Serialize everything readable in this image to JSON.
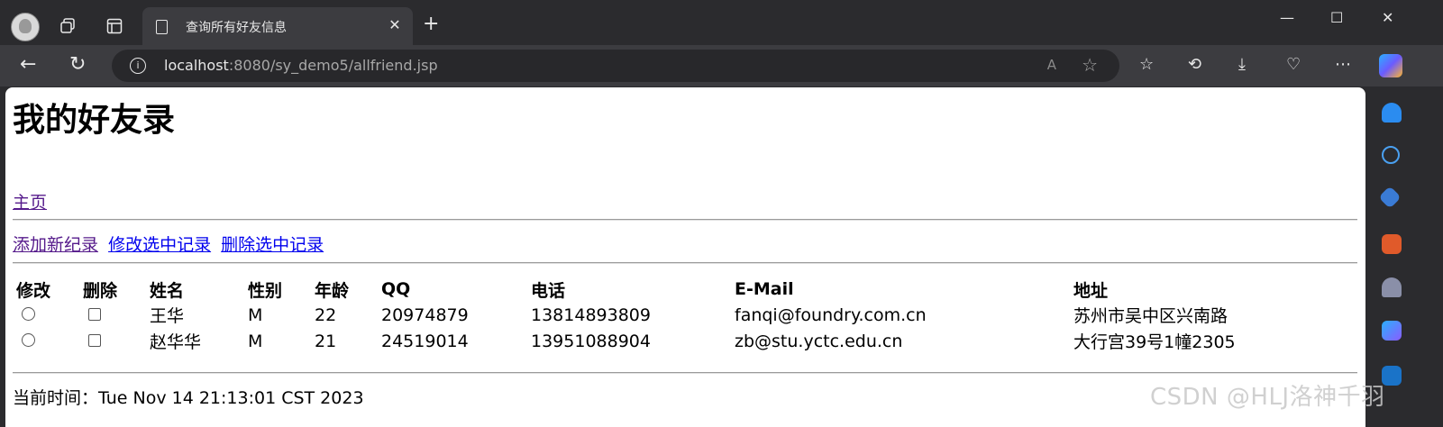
{
  "browser": {
    "tab_title": "查询所有好友信息",
    "tab_close": "✕",
    "new_tab": "+",
    "url_host": "localhost",
    "url_rest": ":8080/sy_demo5/allfriend.jsp",
    "window_controls": {
      "minimize": "—",
      "maximize": "☐",
      "close": "✕"
    }
  },
  "page": {
    "heading": "我的好友录",
    "home_link": "主页",
    "actions": [
      "添加新纪录",
      "修改选中记录",
      "删除选中记录"
    ],
    "table": {
      "headers": [
        "修改",
        "删除",
        "姓名",
        "性别",
        "年龄",
        "QQ",
        "电话",
        "E-Mail",
        "地址"
      ],
      "rows": [
        {
          "name": "王华",
          "gender": "M",
          "age": "22",
          "qq": "20974879",
          "phone": "13814893809",
          "email": "fanqi@foundry.com.cn",
          "address": "苏州市吴中区兴南路"
        },
        {
          "name": "赵华华",
          "gender": "M",
          "age": "21",
          "qq": "24519014",
          "phone": "13951088904",
          "email": "zb@stu.yctc.edu.cn",
          "address": "大行宫39号1幢2305"
        }
      ]
    },
    "time_label": "当前时间：Tue Nov 14 21:13:01 CST 2023"
  },
  "watermark": "CSDN @HLJ洛神千羽",
  "colors": {
    "visited_link": "#551a8b",
    "link": "#0000ee",
    "browser_dark": "#2b2b2e"
  }
}
